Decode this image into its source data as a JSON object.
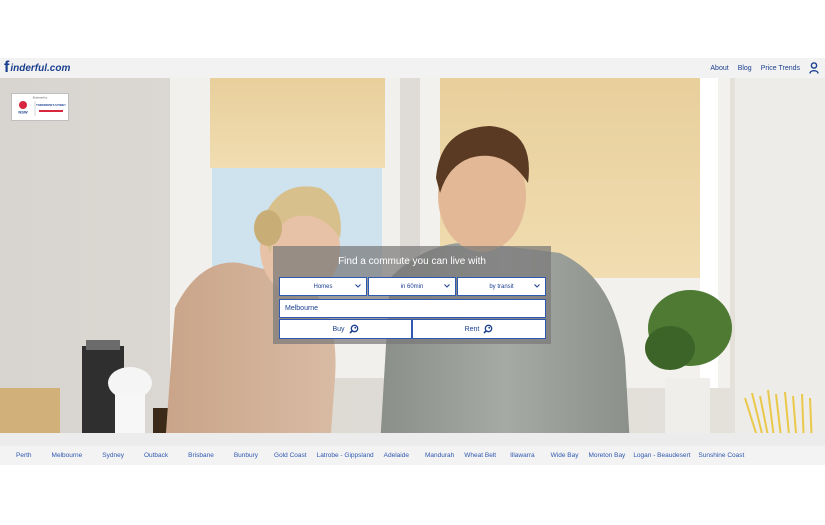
{
  "header": {
    "logo_text": "inderful.com",
    "logo_letter": "f",
    "nav": [
      "About",
      "Blog",
      "Price Trends"
    ]
  },
  "badge": {
    "small_text": "Endorsed by",
    "left": "NSW",
    "right": "TOMORROW'S SYDNEY"
  },
  "search": {
    "title": "Find a commute you can live with",
    "type": "Homes",
    "time": "in 60min",
    "mode": "by transit",
    "location": "Melbourne",
    "buy_label": "Buy",
    "rent_label": "Rent"
  },
  "cities": [
    "Perth",
    "Melbourne",
    "Sydney",
    "Outback",
    "Brisbane",
    "Bunbury",
    "Gold Coast",
    "Latrobe - Gippsland",
    "Adelaide",
    "Mandurah",
    "Wheat Belt",
    "Illawarra",
    "Wide Bay",
    "Moreton Bay",
    "Logan - Beaudesert",
    "Sunshine Coast"
  ],
  "colors": {
    "brand": "#1a3f8f",
    "link": "#2f58b0",
    "overlay": "#787878"
  }
}
